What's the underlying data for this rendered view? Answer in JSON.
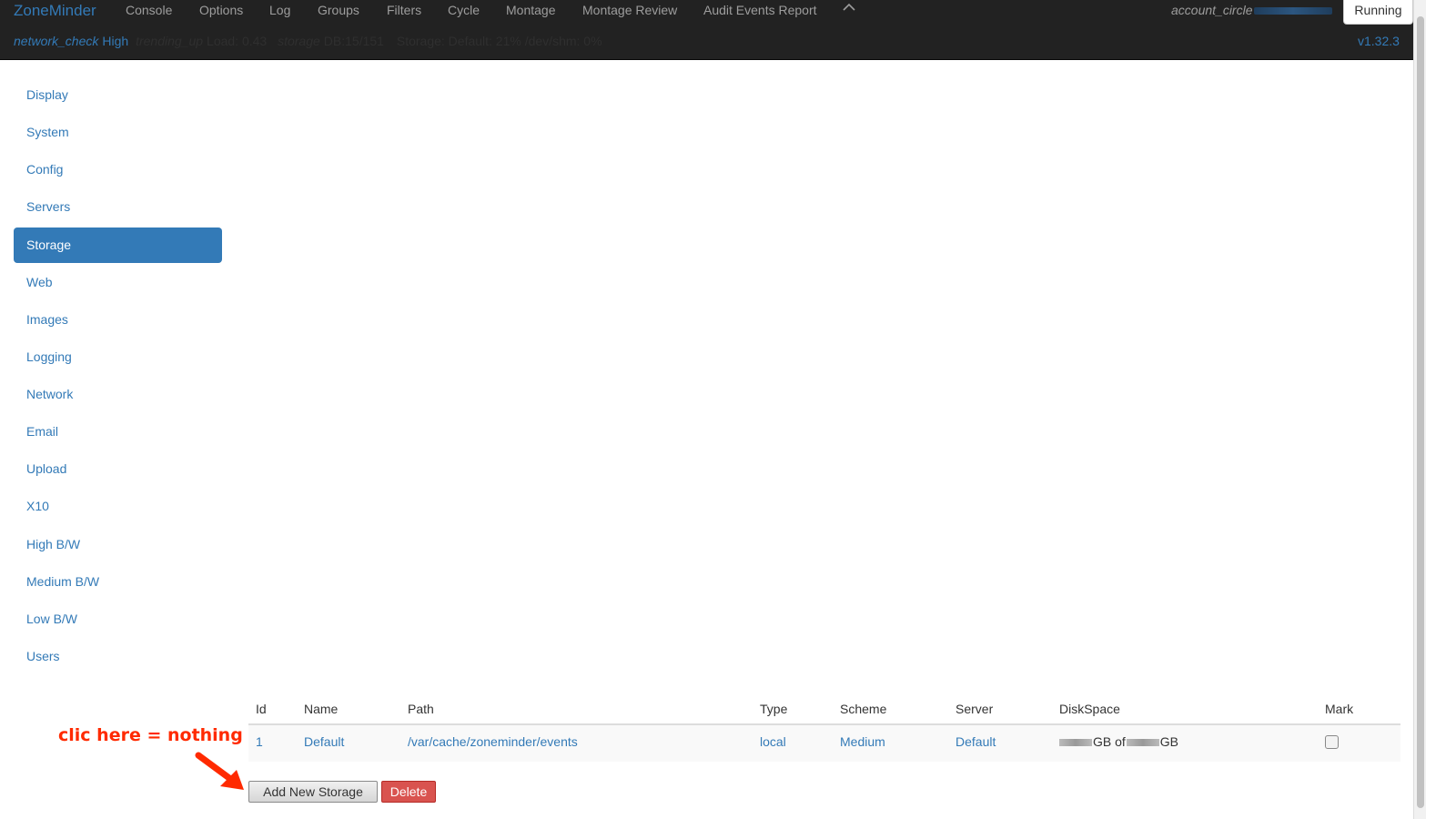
{
  "nav": {
    "brand": "ZoneMinder",
    "items": [
      "Console",
      "Options",
      "Log",
      "Groups",
      "Filters",
      "Cycle",
      "Montage",
      "Montage Review",
      "Audit Events Report"
    ],
    "account": "account_circle",
    "running": "Running",
    "version": "v1.32.3"
  },
  "status": {
    "network_icon": "network_check",
    "bandwidth": "High",
    "load_icon": "trending_up",
    "load": "Load: 0.43",
    "storage_icon": "storage",
    "db": "DB:15/151",
    "storage": "Storage: Default: 21% /dev/shm: 0%"
  },
  "sidebar": {
    "items": [
      "Display",
      "System",
      "Config",
      "Servers",
      "Storage",
      "Web",
      "Images",
      "Logging",
      "Network",
      "Email",
      "Upload",
      "X10",
      "High B/W",
      "Medium B/W",
      "Low B/W",
      "Users"
    ],
    "active": "Storage"
  },
  "table": {
    "headers": [
      "Id",
      "Name",
      "Path",
      "Type",
      "Scheme",
      "Server",
      "DiskSpace",
      "Mark"
    ],
    "rows": [
      {
        "id": "1",
        "name": "Default",
        "path": "/var/cache/zoneminder/events",
        "type": "local",
        "scheme": "Medium",
        "server": "Default",
        "disk_unit_a": "GB of",
        "disk_unit_b": "GB"
      }
    ]
  },
  "buttons": {
    "add": "Add New Storage",
    "delete": "Delete"
  },
  "annotation": "clic here = nothing",
  "colors": {
    "navbar": "#222222",
    "link": "#337ab7",
    "active_bg": "#337ab7",
    "danger": "#d9534f",
    "annotation": "#ff2a00"
  }
}
